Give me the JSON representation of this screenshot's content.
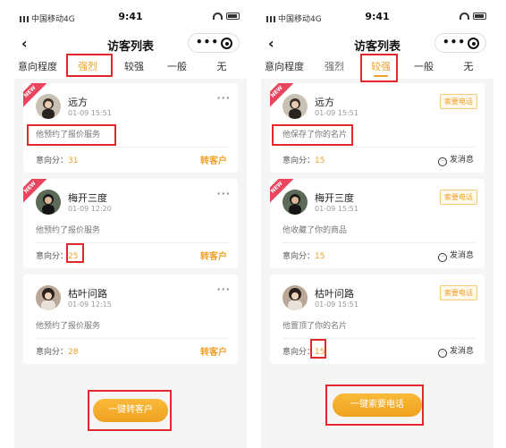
{
  "status": {
    "carrier": "中国移动4G",
    "time": "9:41"
  },
  "nav": {
    "title": "访客列表"
  },
  "colors": {
    "accent": "#f0a02a",
    "highlight": "#e0282e",
    "ribbon": "#e9455f"
  },
  "tab_label": "意向程度",
  "tabs": [
    "强烈",
    "较强",
    "一般",
    "无"
  ],
  "badge": "NEW",
  "score_label": "意向分：",
  "left": {
    "active_tab": "强烈",
    "cards": [
      {
        "name": "远方",
        "time": "01-09 15:51",
        "action": "他预约了报价服务",
        "score": "31",
        "is_new": true,
        "cta": "转客户"
      },
      {
        "name": "梅开三度",
        "time": "01-09 12:20",
        "action": "他预约了报价服务",
        "score": "25",
        "is_new": true,
        "cta": "转客户"
      },
      {
        "name": "枯叶问路",
        "time": "01-09 12:15",
        "action": "他预约了报价服务",
        "score": "28",
        "is_new": false,
        "cta": "转客户"
      }
    ],
    "bottom_button": "一键转客户"
  },
  "right": {
    "active_tab": "较强",
    "cards": [
      {
        "name": "远方",
        "time": "01-09 15:51",
        "action": "他保存了你的名片",
        "score": "15",
        "is_new": true,
        "phone_button": "索要电话",
        "msg_label": "发消息"
      },
      {
        "name": "梅开三度",
        "time": "01-09 15:51",
        "action": "他收藏了你的商品",
        "score": "15",
        "is_new": true,
        "phone_button": "索要电话",
        "msg_label": "发消息"
      },
      {
        "name": "枯叶问路",
        "time": "01-09 15:51",
        "action": "他置顶了你的名片",
        "score": "15",
        "is_new": false,
        "phone_button": "索要电话",
        "msg_label": "发消息"
      }
    ],
    "bottom_button": "一键索要电话"
  }
}
